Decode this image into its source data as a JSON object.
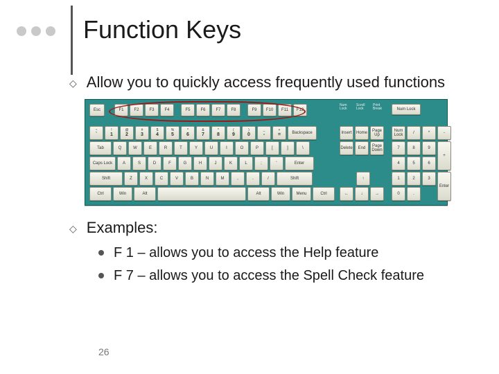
{
  "title": "Function Keys",
  "bullets": {
    "b1": "Allow you to quickly access frequently used functions",
    "b2_header": "Examples:",
    "b2_items": [
      "F 1 – allows you to access the Help feature",
      "F 7 – allows you to access the Spell Check feature"
    ]
  },
  "page_number": "26",
  "keyboard": {
    "esc": "Esc",
    "function_keys": [
      "F1",
      "F2",
      "F3",
      "F4",
      "F5",
      "F6",
      "F7",
      "F8",
      "F9",
      "F10",
      "F11",
      "F12"
    ],
    "indicator_labels": [
      "Num Lock",
      "Scroll Lock",
      "Print Break"
    ],
    "row1_top": [
      "~",
      "!",
      "@",
      "#",
      "$",
      "%",
      "^",
      "&",
      "*",
      "(",
      ")",
      "_",
      "+"
    ],
    "row1_bottom": [
      "`",
      "1",
      "2",
      "3",
      "4",
      "5",
      "6",
      "7",
      "8",
      "9",
      "0",
      "-",
      "="
    ],
    "backspace": "Backspace",
    "tab": "Tab",
    "row2": [
      "Q",
      "W",
      "E",
      "R",
      "T",
      "Y",
      "U",
      "I",
      "O",
      "P",
      "[",
      "]",
      "\\"
    ],
    "caps": "Caps Lock",
    "row3": [
      "A",
      "S",
      "D",
      "F",
      "G",
      "H",
      "J",
      "K",
      "L",
      ";",
      "'"
    ],
    "enter": "Enter",
    "lshift": "Shift",
    "row4": [
      "Z",
      "X",
      "C",
      "V",
      "B",
      "N",
      "M",
      ",",
      ".",
      "/"
    ],
    "rshift": "Shift",
    "bottom_row": [
      "Ctrl",
      "Win",
      "Alt",
      " ",
      "Alt",
      "Win",
      "Menu",
      "Ctrl"
    ],
    "nav_top": [
      "Insert",
      "Home",
      "Page Up"
    ],
    "nav_bot": [
      "Delete",
      "End",
      "Page Down"
    ],
    "arrows": {
      "up": "↑",
      "left": "←",
      "down": "↓",
      "right": "→"
    },
    "numpad_top": [
      "Num Lock",
      "/",
      "*",
      "-"
    ],
    "numpad_r1": [
      "7",
      "8",
      "9"
    ],
    "numpad_r2": [
      "4",
      "5",
      "6"
    ],
    "numpad_r3": [
      "1",
      "2",
      "3"
    ],
    "numpad_r4": [
      "0",
      "."
    ],
    "numpad_plus": "+",
    "numpad_enter": "Enter"
  }
}
